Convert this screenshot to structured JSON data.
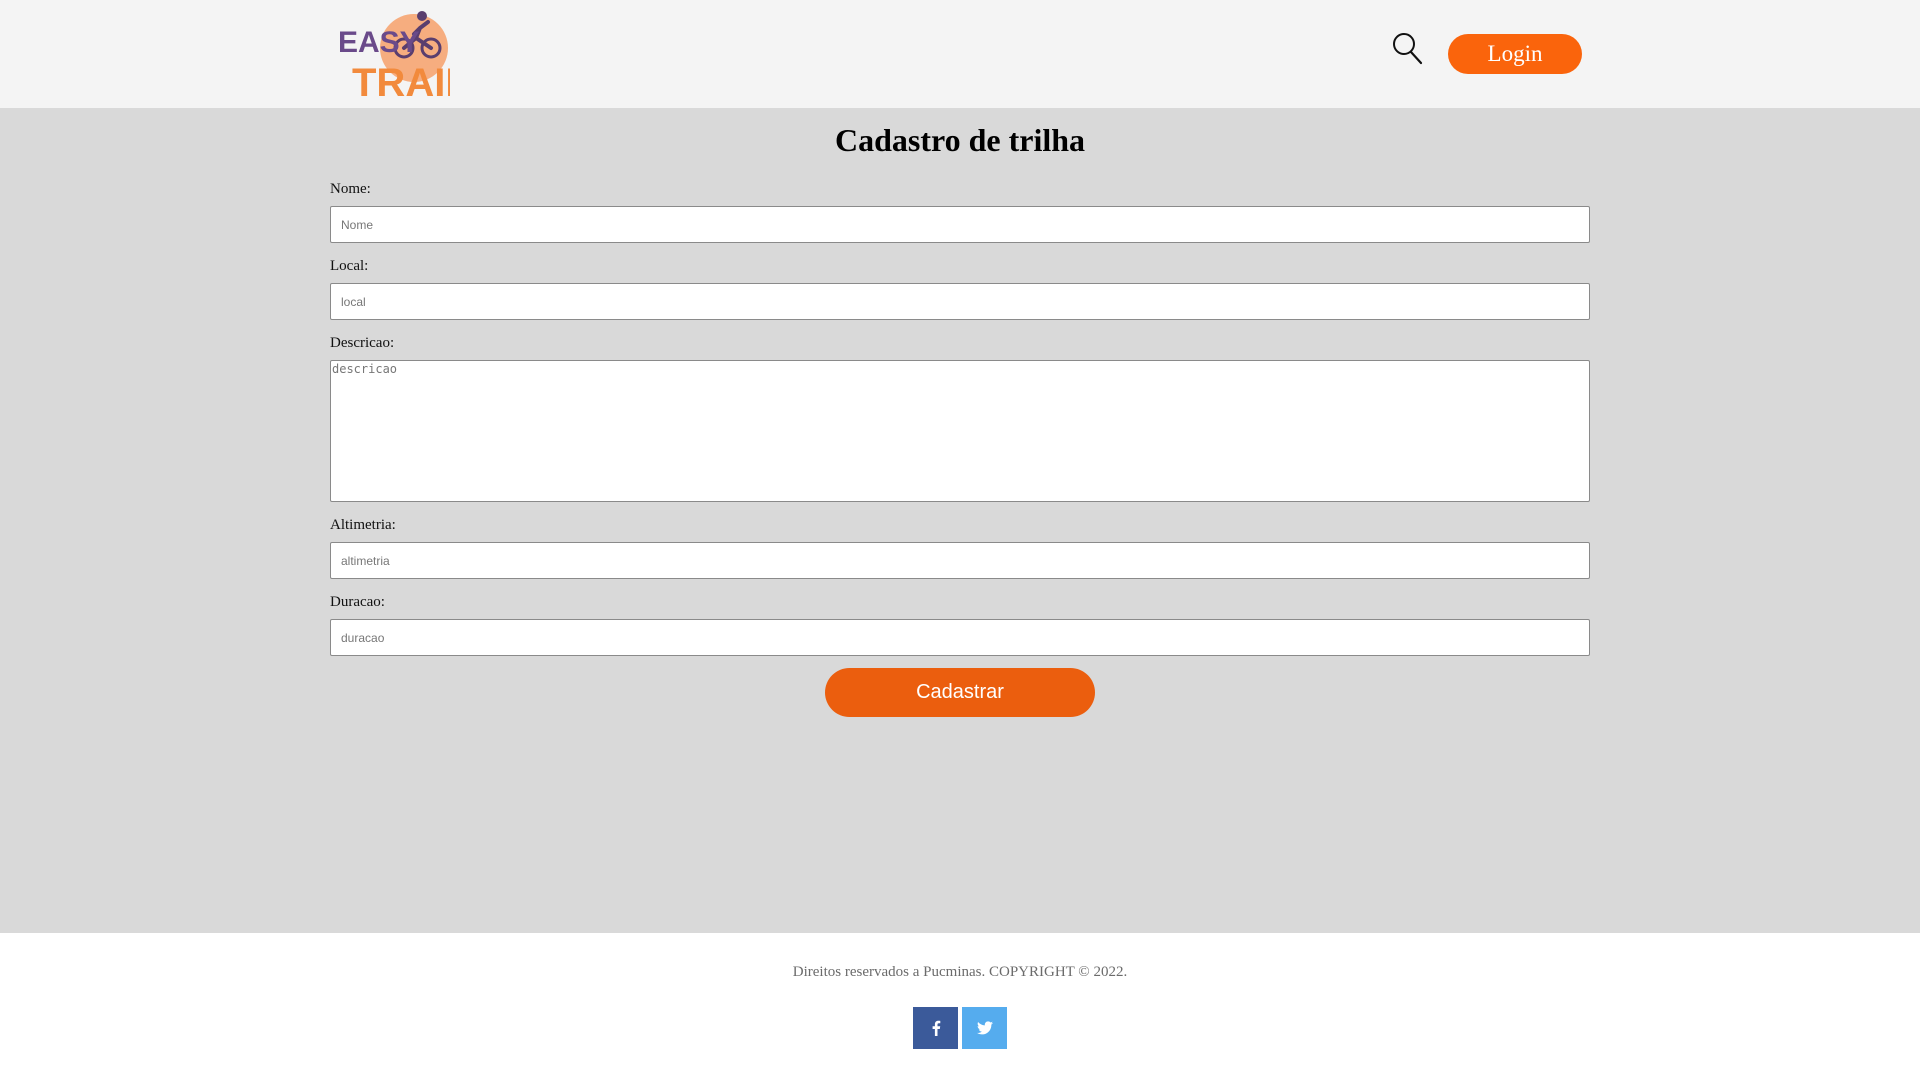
{
  "header": {
    "logo_text_top": "EASY",
    "logo_text_bottom": "TRAIL",
    "search_icon": "search-icon",
    "login_label": "Login"
  },
  "page": {
    "title": "Cadastro de trilha"
  },
  "form": {
    "nome": {
      "label": "Nome:",
      "placeholder": "Nome",
      "value": ""
    },
    "local": {
      "label": "Local:",
      "placeholder": "local",
      "value": ""
    },
    "descricao": {
      "label": "Descricao:",
      "placeholder": "descricao",
      "value": ""
    },
    "altimetria": {
      "label": "Altimetria:",
      "placeholder": "altimetria",
      "value": ""
    },
    "duracao": {
      "label": "Duracao:",
      "placeholder": "duracao",
      "value": ""
    },
    "submit_label": "Cadastrar"
  },
  "footer": {
    "copyright": "Direitos reservados a Pucminas. COPYRIGHT © 2022.",
    "social": [
      {
        "name": "facebook-icon",
        "color": "#3b5a9a"
      },
      {
        "name": "twitter-icon",
        "color": "#55acee"
      }
    ]
  },
  "colors": {
    "accent": "#fa640c",
    "submit": "#eb5e0e",
    "header_bg": "#f4f4f4",
    "main_bg": "#d9d9d9"
  }
}
